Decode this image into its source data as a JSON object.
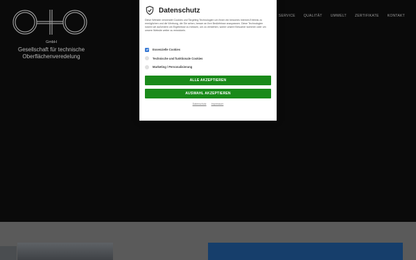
{
  "header": {
    "logo_mark": "OtO",
    "logo_gmbh": "GmbH",
    "logo_line1": "Gesellschaft für technische",
    "logo_line2": "Oberflächenveredelung",
    "nav": [
      "SERVICE",
      "QUALITÄT",
      "UMWELT",
      "ZERTIFIKATE",
      "KONTAKT"
    ]
  },
  "cookie_modal": {
    "title": "Datenschutz",
    "description": "Diese Website verwendet Cookies und Targeting Technologien um Ihnen ein besseres Internet-Erlebnis zu ermöglichen und die Werbung, die Sie sehen, besser an Ihre Bedürfnisse anzupassen. Diese Technologien nutzen wir außerdem um Ergebnisse zu messen, um zu verstehen, woher unsere Besucher kommen oder um unsere Website weiter zu entwickeln.",
    "options": [
      {
        "label": "Essenzielle Cookies",
        "checked": true
      },
      {
        "label": "Technische und funktionale Cookies",
        "checked": false
      },
      {
        "label": "Marketing / Personalisierung",
        "checked": false
      }
    ],
    "accept_all": "ALLE AKZEPTIEREN",
    "accept_selection": "AUSWAHL AKZEPTIEREN",
    "link_privacy": "Datenschutz",
    "link_imprint": "Impressum",
    "accent_color": "#1a8a1a",
    "checkbox_color": "#3a7bd5"
  }
}
